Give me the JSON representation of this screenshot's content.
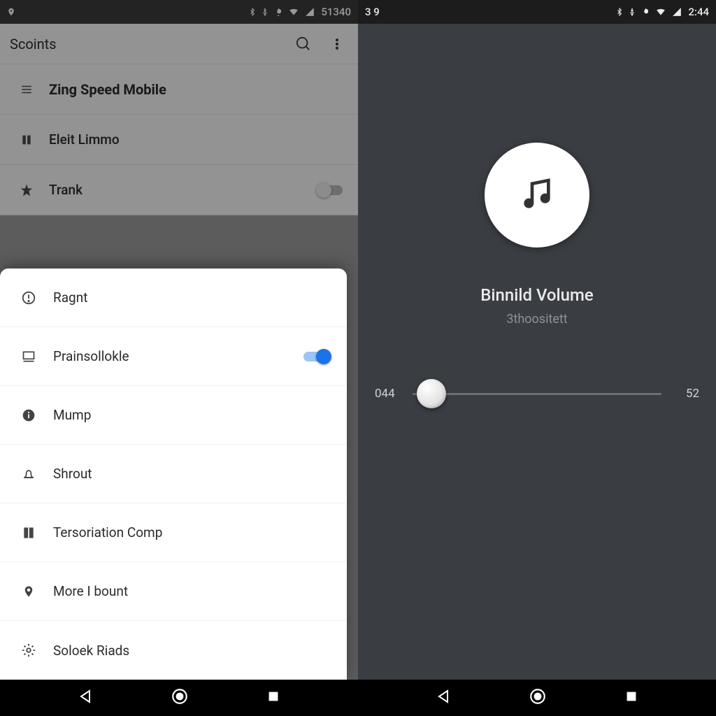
{
  "left": {
    "status": {
      "time": "51340"
    },
    "appbar": {
      "title": "Scoints"
    },
    "bg_items": [
      {
        "icon": "menu",
        "label": "Zing Speed Mobile",
        "bold": true
      },
      {
        "icon": "pause",
        "label": "Eleit Limmo"
      },
      {
        "icon": "star",
        "label": "Trank",
        "switch": "off"
      }
    ],
    "sheet": [
      {
        "icon": "alert",
        "label": "Ragnt"
      },
      {
        "icon": "monitor",
        "label": "Prainsollokle",
        "switch": "on"
      },
      {
        "icon": "info",
        "label": "Mump"
      },
      {
        "icon": "bell",
        "label": "Shrout"
      },
      {
        "icon": "book",
        "label": "Tersoriation Comp"
      },
      {
        "icon": "pin",
        "label": "More I bount"
      },
      {
        "icon": "gear",
        "label": "Soloek Riads"
      }
    ]
  },
  "right": {
    "status": {
      "left_badge": "3 9",
      "time": "2:44"
    },
    "track": {
      "title": "Binnild Volume",
      "subtitle": "3thoositett",
      "time_elapsed": "044",
      "time_total": "52"
    }
  }
}
